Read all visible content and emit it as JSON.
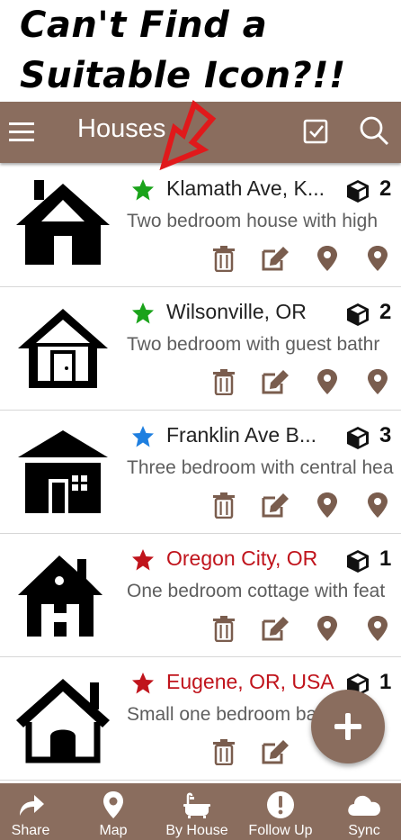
{
  "headline": {
    "line1": "Can't Find a",
    "line2": "Suitable Icon?!!"
  },
  "appbar": {
    "title": "Houses",
    "menu_icon": "hamburger-menu-icon",
    "check_icon": "checkbox-icon",
    "search_icon": "search-icon"
  },
  "items": [
    {
      "name": "Klamath Ave, K...",
      "description": "Two bedroom house with high",
      "count": "2",
      "star_color": "#1aa31a",
      "name_color": "#222222",
      "house_icon": "house-icon"
    },
    {
      "name": "Wilsonville, OR",
      "description": "Two bedroom with guest bathr",
      "count": "2",
      "star_color": "#1aa31a",
      "name_color": "#222222",
      "house_icon": "house-door-icon"
    },
    {
      "name": "Franklin Ave B...",
      "description": "Three bedroom with central hea",
      "count": "3",
      "star_color": "#1e7fe0",
      "name_color": "#222222",
      "house_icon": "house-window-icon"
    },
    {
      "name": "Oregon City, OR",
      "description": "One bedroom cottage with feat",
      "count": "1",
      "star_color": "#c0141c",
      "name_color": "#c0141c",
      "house_icon": "house-chimney-icon"
    },
    {
      "name": "Eugene, OR, USA",
      "description": "Small one bedroom ba",
      "count": "1",
      "star_color": "#c0141c",
      "name_color": "#c0141c",
      "house_icon": "house-outline-icon"
    }
  ],
  "fab": {
    "icon": "plus-icon"
  },
  "bottom_nav": [
    {
      "label": "Share",
      "icon": "share-icon"
    },
    {
      "label": "Map",
      "icon": "map-pin-icon"
    },
    {
      "label": "By House",
      "icon": "bathtub-icon"
    },
    {
      "label": "Follow Up",
      "icon": "exclamation-icon"
    },
    {
      "label": "Sync",
      "icon": "cloud-icon"
    }
  ],
  "colors": {
    "brand": "#8a6d5e",
    "arrow": "#e0191b"
  }
}
